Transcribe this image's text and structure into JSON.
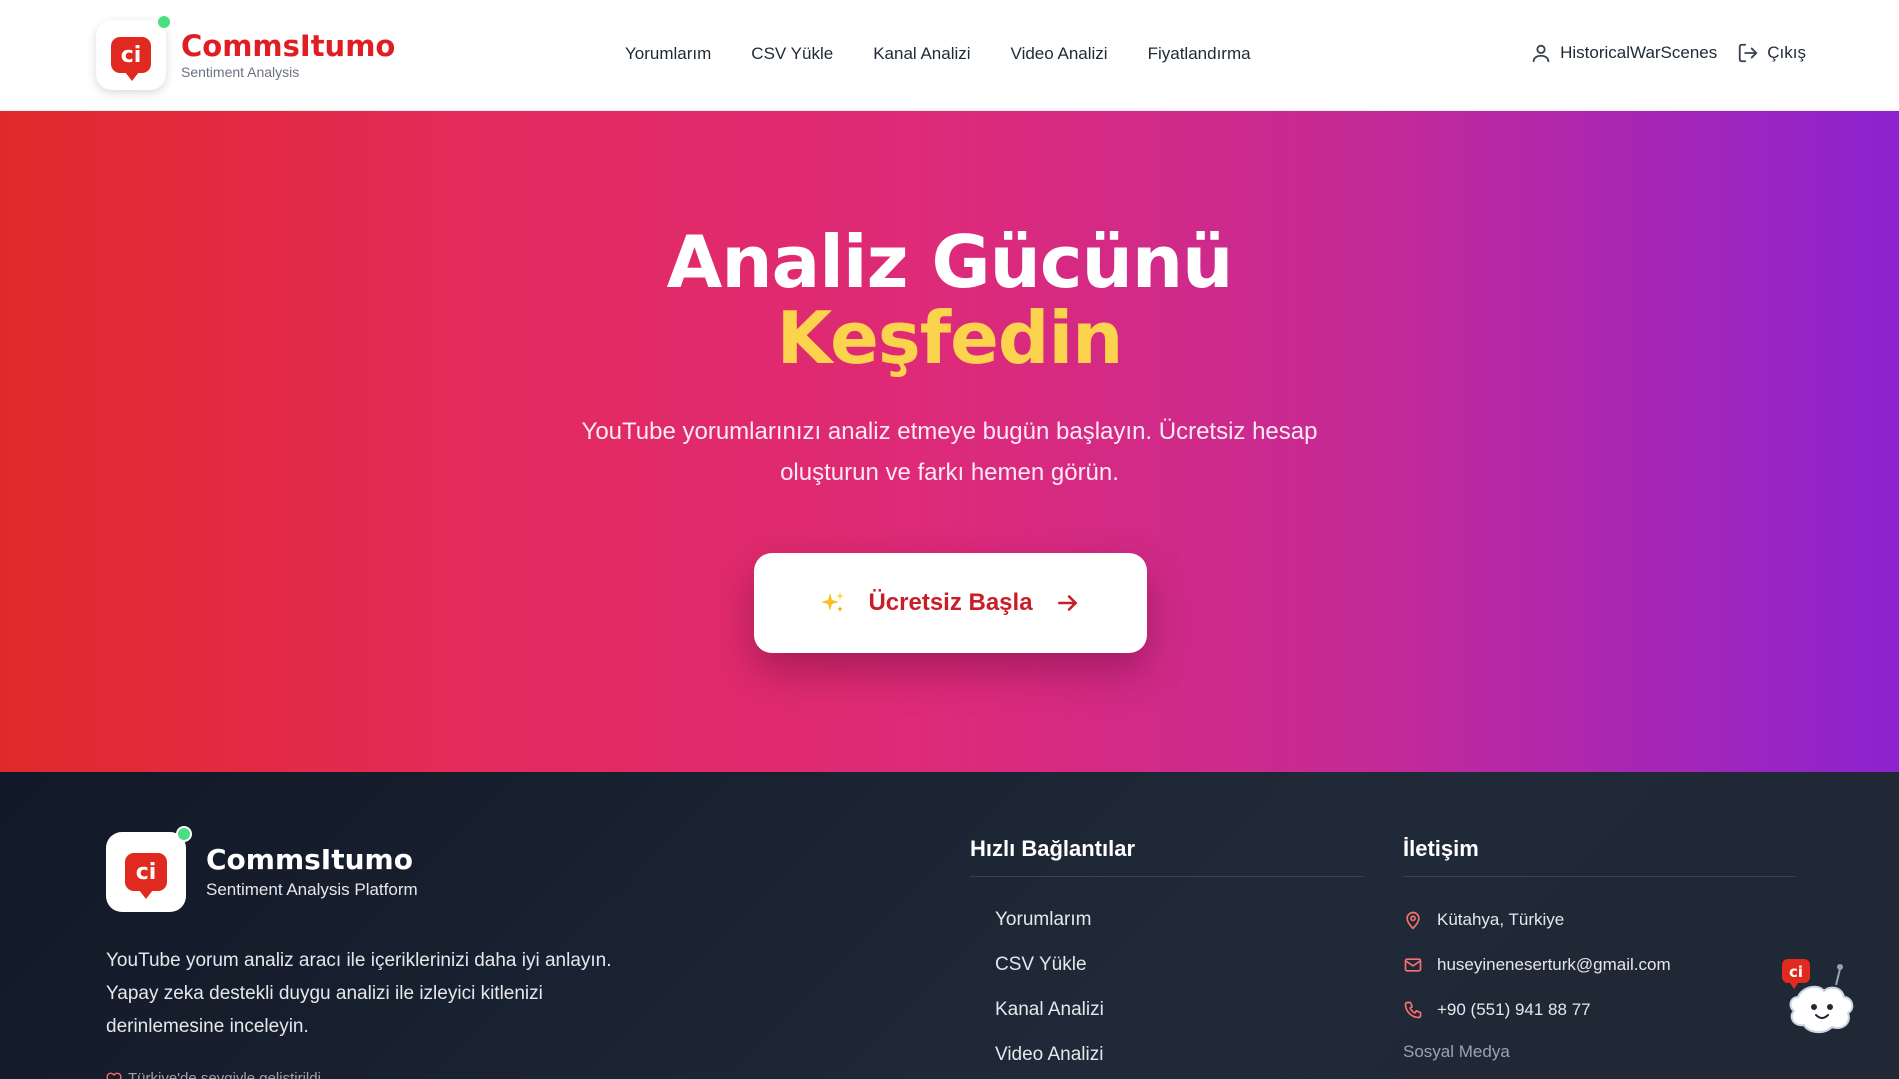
{
  "header": {
    "brand_name": "CommsItumo",
    "brand_subtitle": "Sentiment Analysis",
    "logo_text": "ci",
    "nav": [
      "Yorumlarım",
      "CSV Yükle",
      "Kanal Analizi",
      "Video Analizi",
      "Fiyatlandırma"
    ],
    "username": "HistoricalWarScenes",
    "logout_label": "Çıkış"
  },
  "hero": {
    "title_line1": "Analiz Gücünü",
    "title_line2": "Keşfedin",
    "description_line1": "YouTube yorumlarınızı analiz etmeye bugün başlayın. Ücretsiz hesap",
    "description_line2": "oluşturun ve farkı hemen görün.",
    "cta_label": "Ücretsiz Başla",
    "cta_icon": "sparkles-icon",
    "gradient": [
      "#e02a2a",
      "#dd2a7a",
      "#8c23d0"
    ],
    "accent_color": "#fcd34d"
  },
  "footer": {
    "brand_name": "CommsItumo",
    "brand_subtitle": "Sentiment Analysis Platform",
    "logo_text": "ci",
    "description_line1": "YouTube yorum analiz aracı ile içeriklerinizi daha iyi anlayın.",
    "description_line2": "Yapay zeka destekli duygu analizi ile izleyici kitlenizi",
    "description_line3": "derinlemesine inceleyin.",
    "credit": "Türkiye'de sevgiyle geliştirildi",
    "quick_links_title": "Hızlı Bağlantılar",
    "quick_links": [
      "Yorumlarım",
      "CSV Yükle",
      "Kanal Analizi",
      "Video Analizi"
    ],
    "contact_title": "İletişim",
    "contact": {
      "location": "Kütahya, Türkiye",
      "email": "huseyineneserturk@gmail.com",
      "phone": "+90 (551) 941 88 77"
    },
    "social_title": "Sosyal Medya"
  },
  "colors": {
    "brand": "#e11d24",
    "footer_bg": "#111827",
    "online": "#4ade80"
  }
}
